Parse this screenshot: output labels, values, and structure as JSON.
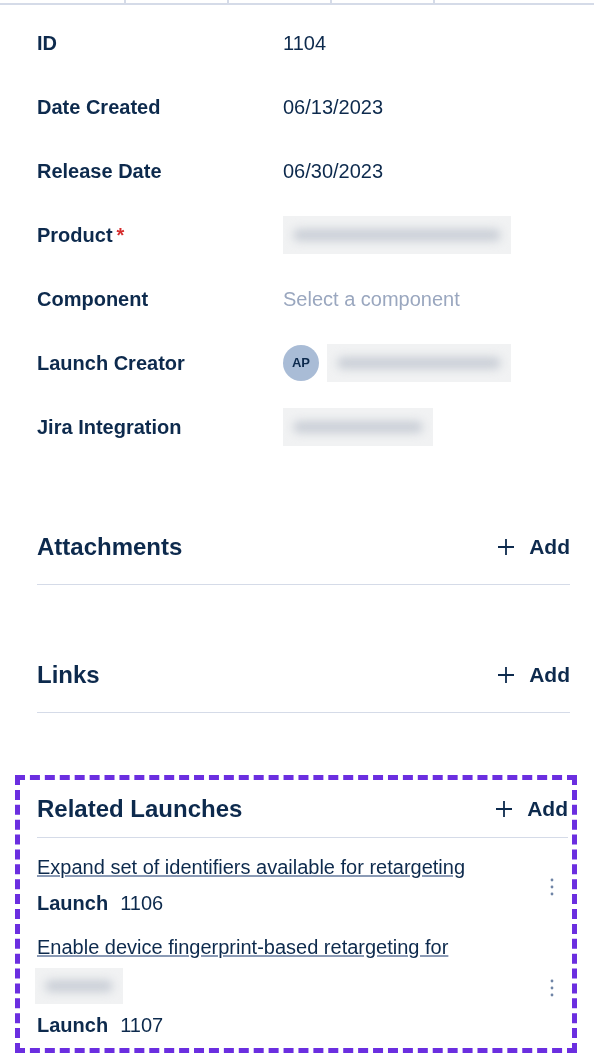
{
  "fields": [
    {
      "label": "ID",
      "kind": "text",
      "value": "1104"
    },
    {
      "label": "Date Created",
      "kind": "text",
      "value": "06/13/2023"
    },
    {
      "label": "Release Date",
      "kind": "text",
      "value": "06/30/2023"
    },
    {
      "label": "Product",
      "required_mark": "*",
      "kind": "redacted"
    },
    {
      "label": "Component",
      "kind": "select",
      "placeholder": "Select a component"
    },
    {
      "label": "Launch Creator",
      "kind": "user",
      "initials": "AP"
    },
    {
      "label": "Jira Integration",
      "kind": "redacted_short"
    }
  ],
  "sections": [
    {
      "title": "Attachments",
      "add": "Add",
      "highlighted": false
    },
    {
      "title": "Links",
      "add": "Add",
      "highlighted": false
    },
    {
      "title": "Related Launches",
      "add": "Add",
      "highlighted": true,
      "items": [
        {
          "title": "Expand set of identifiers available for retargeting",
          "redacted_tail": false,
          "type_label": "Launch",
          "number": "1106"
        },
        {
          "title": "Enable device fingerprint-based retargeting for",
          "redacted_tail": true,
          "type_label": "Launch",
          "number": "1107"
        }
      ]
    }
  ]
}
